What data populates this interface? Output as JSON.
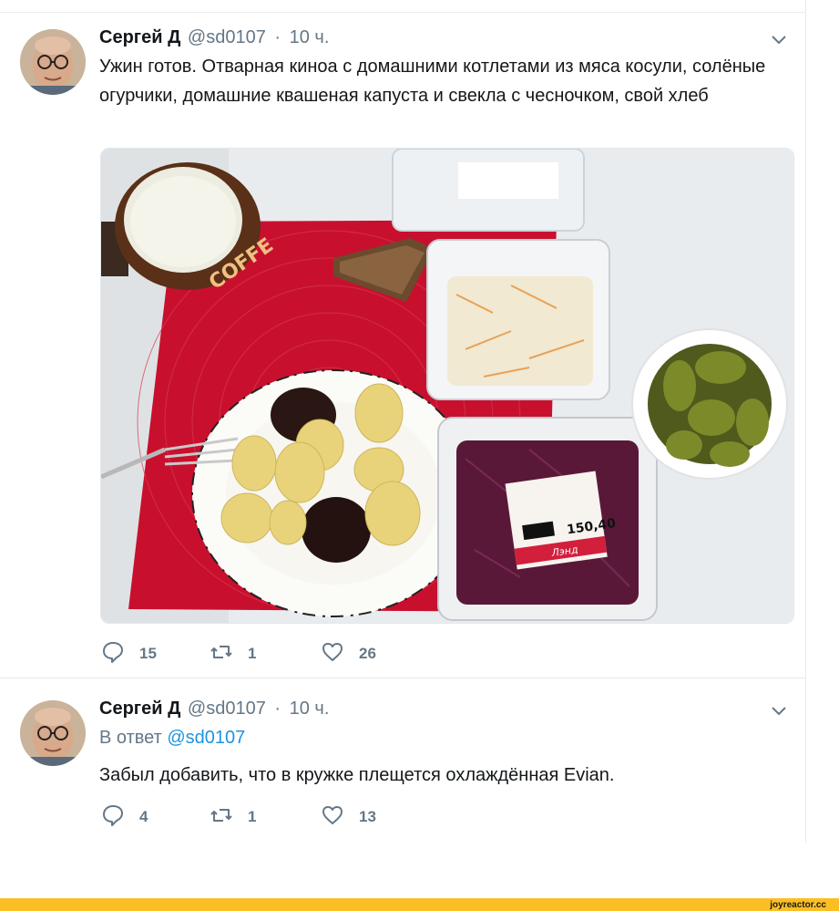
{
  "tweets": [
    {
      "author_name": "Сергей Д",
      "handle": "@sd0107",
      "separator": "·",
      "time": "10 ч.",
      "text": "Ужин готов. Отварная киноа с домашними котлетами из мяса косули, солёные огурчики, домашние квашеная капуста и свекла с чесночком, свой хлеб",
      "actions": {
        "replies": "15",
        "retweets": "1",
        "likes": "26"
      },
      "media": {
        "image_labels": {
          "mug_text": "COFFE",
          "price_label": "150,40",
          "store_label": "Лэнд"
        }
      }
    },
    {
      "author_name": "Сергей Д",
      "handle": "@sd0107",
      "separator": "·",
      "time": "10 ч.",
      "reply_prefix": "В ответ",
      "reply_handle": "@sd0107",
      "text": "Забыл добавить, что в кружке плещется охлаждённая Evian.",
      "actions": {
        "replies": "4",
        "retweets": "1",
        "likes": "13"
      }
    }
  ],
  "watermark": "joyreactor.cc",
  "colors": {
    "link": "#1b95e0",
    "muted": "#657786",
    "watermark_bar": "#fbbf24",
    "placemat": "#c8102e"
  }
}
